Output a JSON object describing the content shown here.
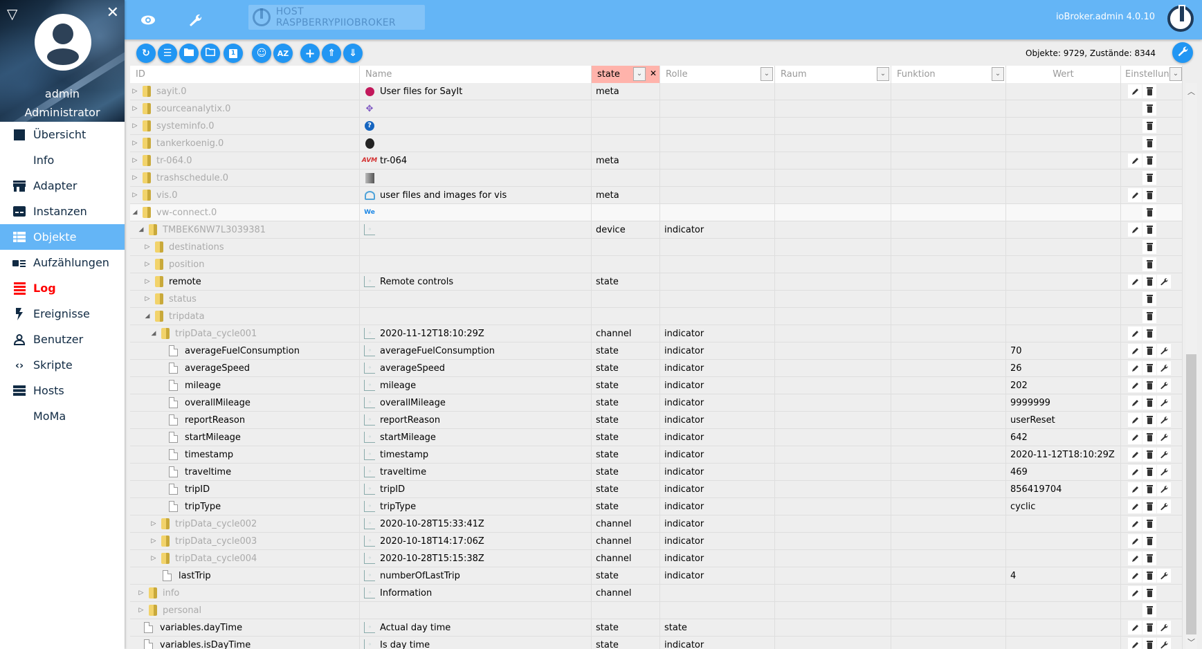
{
  "sidebar": {
    "user_name": "admin",
    "user_role": "Administrator",
    "items": [
      {
        "label": "Übersicht",
        "icon": "apps-grid-icon"
      },
      {
        "label": "Info",
        "icon": "info-icon"
      },
      {
        "label": "Adapter",
        "icon": "store-icon"
      },
      {
        "label": "Instanzen",
        "icon": "instances-icon"
      },
      {
        "label": "Objekte",
        "icon": "list-icon",
        "active": true
      },
      {
        "label": "Aufzählungen",
        "icon": "enum-icon"
      },
      {
        "label": "Log",
        "icon": "log-lines-icon",
        "highlight_color": "#ff0000"
      },
      {
        "label": "Ereignisse",
        "icon": "flash-icon"
      },
      {
        "label": "Benutzer",
        "icon": "user-icon"
      },
      {
        "label": "Skripte",
        "icon": "code-icon"
      },
      {
        "label": "Hosts",
        "icon": "server-icon"
      },
      {
        "label": "MoMa",
        "icon": "info-icon"
      }
    ]
  },
  "topbar": {
    "host": "HOST RASPBERRYPIIOBROKER",
    "version": "ioBroker.admin 4.0.10",
    "accent": "#64b5f6"
  },
  "toolbar": {
    "buttons": [
      "refresh",
      "list-view",
      "folder",
      "folder-open",
      "one",
      "expert-mode",
      "sort-az",
      "add",
      "upload",
      "download"
    ],
    "stats": "Objekte: 9729, Zustände: 8344",
    "button_color": "#2196f3"
  },
  "table": {
    "headers": {
      "id": "ID",
      "name": "Name",
      "type_filter": "state",
      "role": "Rolle",
      "room": "Raum",
      "function": "Funktion",
      "value": "Wert",
      "settings": "Einstellungen"
    },
    "rows": [
      {
        "id": "sayit.0",
        "level": 0,
        "kind": "folder",
        "tw": "closed",
        "dim": true,
        "name": "User files for SayIt",
        "nicon": "sayit",
        "type": "meta",
        "role": "",
        "value": "",
        "actions": [
          "edit",
          "delete"
        ]
      },
      {
        "id": "sourceanalytix.0",
        "level": 0,
        "kind": "folder",
        "tw": "closed",
        "dim": true,
        "name": "",
        "nicon": "sourceanalytix",
        "type": "",
        "role": "",
        "value": "",
        "actions": [
          "",
          "delete"
        ]
      },
      {
        "id": "systeminfo.0",
        "level": 0,
        "kind": "folder",
        "tw": "closed",
        "dim": true,
        "name": "",
        "nicon": "systeminfo",
        "type": "",
        "role": "",
        "value": "",
        "actions": [
          "",
          "delete"
        ]
      },
      {
        "id": "tankerkoenig.0",
        "level": 0,
        "kind": "folder",
        "tw": "closed",
        "dim": true,
        "name": "",
        "nicon": "tankerkoenig",
        "type": "",
        "role": "",
        "value": "",
        "actions": [
          "",
          "delete"
        ]
      },
      {
        "id": "tr-064.0",
        "level": 0,
        "kind": "folder",
        "tw": "closed",
        "dim": true,
        "name": "tr-064",
        "nicon": "avm",
        "type": "meta",
        "role": "",
        "value": "",
        "actions": [
          "edit",
          "delete"
        ]
      },
      {
        "id": "trashschedule.0",
        "level": 0,
        "kind": "folder",
        "tw": "closed",
        "dim": true,
        "name": "",
        "nicon": "trash",
        "type": "",
        "role": "",
        "value": "",
        "actions": [
          "",
          "delete"
        ]
      },
      {
        "id": "vis.0",
        "level": 0,
        "kind": "folder",
        "tw": "closed",
        "dim": true,
        "name": "user files and images for vis",
        "nicon": "vis",
        "type": "meta",
        "role": "",
        "value": "",
        "actions": [
          "edit",
          "delete"
        ]
      },
      {
        "id": "vw-connect.0",
        "level": 0,
        "kind": "folder",
        "tw": "open",
        "dim": true,
        "hl": true,
        "name": "",
        "nicon": "vw",
        "type": "",
        "role": "",
        "value": "",
        "actions": [
          "",
          "delete"
        ]
      },
      {
        "id": "TMBEK6NW7L3039381",
        "level": 1,
        "kind": "folder",
        "tw": "open",
        "dim": true,
        "name": "",
        "nicon": "state",
        "type": "device",
        "role": "indicator",
        "value": "",
        "actions": [
          "edit",
          "delete"
        ]
      },
      {
        "id": "destinations",
        "level": 2,
        "kind": "folder",
        "tw": "closed",
        "dim": true,
        "name": "",
        "nicon": "",
        "type": "",
        "role": "",
        "value": "",
        "actions": [
          "",
          "delete"
        ]
      },
      {
        "id": "position",
        "level": 2,
        "kind": "folder",
        "tw": "closed",
        "dim": true,
        "name": "",
        "nicon": "",
        "type": "",
        "role": "",
        "value": "",
        "actions": [
          "",
          "delete"
        ]
      },
      {
        "id": "remote",
        "level": 2,
        "kind": "folder",
        "tw": "closed",
        "dim": false,
        "name": "Remote controls",
        "nicon": "state",
        "type": "state",
        "role": "",
        "value": "",
        "actions": [
          "edit",
          "delete",
          "settings"
        ]
      },
      {
        "id": "status",
        "level": 2,
        "kind": "folder",
        "tw": "closed",
        "dim": true,
        "name": "",
        "nicon": "",
        "type": "",
        "role": "",
        "value": "",
        "actions": [
          "",
          "delete"
        ]
      },
      {
        "id": "tripdata",
        "level": 2,
        "kind": "folder",
        "tw": "open",
        "dim": true,
        "name": "",
        "nicon": "",
        "type": "",
        "role": "",
        "value": "",
        "actions": [
          "",
          "delete"
        ]
      },
      {
        "id": "tripData_cycle001",
        "level": 3,
        "kind": "folder",
        "tw": "open",
        "dim": true,
        "name": "2020-11-12T18:10:29Z",
        "nicon": "state",
        "type": "channel",
        "role": "indicator",
        "value": "",
        "actions": [
          "edit",
          "delete"
        ]
      },
      {
        "id": "averageFuelConsumption",
        "level": 4,
        "kind": "file",
        "tw": "",
        "dim": false,
        "name": "averageFuelConsumption",
        "nicon": "state",
        "type": "state",
        "role": "indicator",
        "value": "70",
        "actions": [
          "edit",
          "delete",
          "settings"
        ]
      },
      {
        "id": "averageSpeed",
        "level": 4,
        "kind": "file",
        "tw": "",
        "dim": false,
        "name": "averageSpeed",
        "nicon": "state",
        "type": "state",
        "role": "indicator",
        "value": "26",
        "actions": [
          "edit",
          "delete",
          "settings"
        ]
      },
      {
        "id": "mileage",
        "level": 4,
        "kind": "file",
        "tw": "",
        "dim": false,
        "name": "mileage",
        "nicon": "state",
        "type": "state",
        "role": "indicator",
        "value": "202",
        "actions": [
          "edit",
          "delete",
          "settings"
        ]
      },
      {
        "id": "overallMileage",
        "level": 4,
        "kind": "file",
        "tw": "",
        "dim": false,
        "name": "overallMileage",
        "nicon": "state",
        "type": "state",
        "role": "indicator",
        "value": "9999999",
        "actions": [
          "edit",
          "delete",
          "settings"
        ]
      },
      {
        "id": "reportReason",
        "level": 4,
        "kind": "file",
        "tw": "",
        "dim": false,
        "name": "reportReason",
        "nicon": "state",
        "type": "state",
        "role": "indicator",
        "value": "userReset",
        "actions": [
          "edit",
          "delete",
          "settings"
        ]
      },
      {
        "id": "startMileage",
        "level": 4,
        "kind": "file",
        "tw": "",
        "dim": false,
        "name": "startMileage",
        "nicon": "state",
        "type": "state",
        "role": "indicator",
        "value": "642",
        "actions": [
          "edit",
          "delete",
          "settings"
        ]
      },
      {
        "id": "timestamp",
        "level": 4,
        "kind": "file",
        "tw": "",
        "dim": false,
        "name": "timestamp",
        "nicon": "state",
        "type": "state",
        "role": "indicator",
        "value": "2020-11-12T18:10:29Z",
        "actions": [
          "edit",
          "delete",
          "settings"
        ]
      },
      {
        "id": "traveltime",
        "level": 4,
        "kind": "file",
        "tw": "",
        "dim": false,
        "name": "traveltime",
        "nicon": "state",
        "type": "state",
        "role": "indicator",
        "value": "469",
        "actions": [
          "edit",
          "delete",
          "settings"
        ]
      },
      {
        "id": "tripID",
        "level": 4,
        "kind": "file",
        "tw": "",
        "dim": false,
        "name": "tripID",
        "nicon": "state",
        "type": "state",
        "role": "indicator",
        "value": "856419704",
        "actions": [
          "edit",
          "delete",
          "settings"
        ]
      },
      {
        "id": "tripType",
        "level": 4,
        "kind": "file",
        "tw": "",
        "dim": false,
        "name": "tripType",
        "nicon": "state",
        "type": "state",
        "role": "indicator",
        "value": "cyclic",
        "actions": [
          "edit",
          "delete",
          "settings"
        ]
      },
      {
        "id": "tripData_cycle002",
        "level": 3,
        "kind": "folder",
        "tw": "closed",
        "dim": true,
        "name": "2020-10-28T15:33:41Z",
        "nicon": "state",
        "type": "channel",
        "role": "indicator",
        "value": "",
        "actions": [
          "edit",
          "delete"
        ]
      },
      {
        "id": "tripData_cycle003",
        "level": 3,
        "kind": "folder",
        "tw": "closed",
        "dim": true,
        "name": "2020-10-18T14:17:06Z",
        "nicon": "state",
        "type": "channel",
        "role": "indicator",
        "value": "",
        "actions": [
          "edit",
          "delete"
        ]
      },
      {
        "id": "tripData_cycle004",
        "level": 3,
        "kind": "folder",
        "tw": "closed",
        "dim": true,
        "name": "2020-10-28T15:15:38Z",
        "nicon": "state",
        "type": "channel",
        "role": "indicator",
        "value": "",
        "actions": [
          "edit",
          "delete"
        ]
      },
      {
        "id": "lastTrip",
        "level": 3,
        "kind": "file",
        "tw": "",
        "dim": false,
        "name": "numberOfLastTrip",
        "nicon": "state",
        "type": "state",
        "role": "indicator",
        "value": "4",
        "actions": [
          "edit",
          "delete",
          "settings"
        ]
      },
      {
        "id": "info",
        "level": 1,
        "kind": "folder",
        "tw": "closed",
        "dim": true,
        "name": "Information",
        "nicon": "state",
        "type": "channel",
        "role": "",
        "value": "",
        "actions": [
          "edit",
          "delete"
        ]
      },
      {
        "id": "personal",
        "level": 1,
        "kind": "folder",
        "tw": "closed",
        "dim": true,
        "name": "",
        "nicon": "",
        "type": "",
        "role": "",
        "value": "",
        "actions": [
          "",
          "delete"
        ]
      },
      {
        "id": "variables.dayTime",
        "level": 0,
        "kind": "file",
        "tw": "",
        "dim": false,
        "name": "Actual day time",
        "nicon": "state",
        "type": "state",
        "role": "state",
        "value": "",
        "actions": [
          "edit",
          "delete",
          "settings"
        ]
      },
      {
        "id": "variables.isDayTime",
        "level": 0,
        "kind": "file",
        "tw": "",
        "dim": false,
        "name": "Is day time",
        "nicon": "state",
        "type": "state",
        "role": "indicator",
        "value": "",
        "actions": [
          "edit",
          "delete",
          "settings"
        ]
      }
    ]
  },
  "icons": {
    "tw_closed": "▷",
    "tw_open": "◢",
    "edit": "✎",
    "delete": "🗑",
    "settings": "🔧",
    "dropdown": "⌄",
    "clear": "×"
  }
}
